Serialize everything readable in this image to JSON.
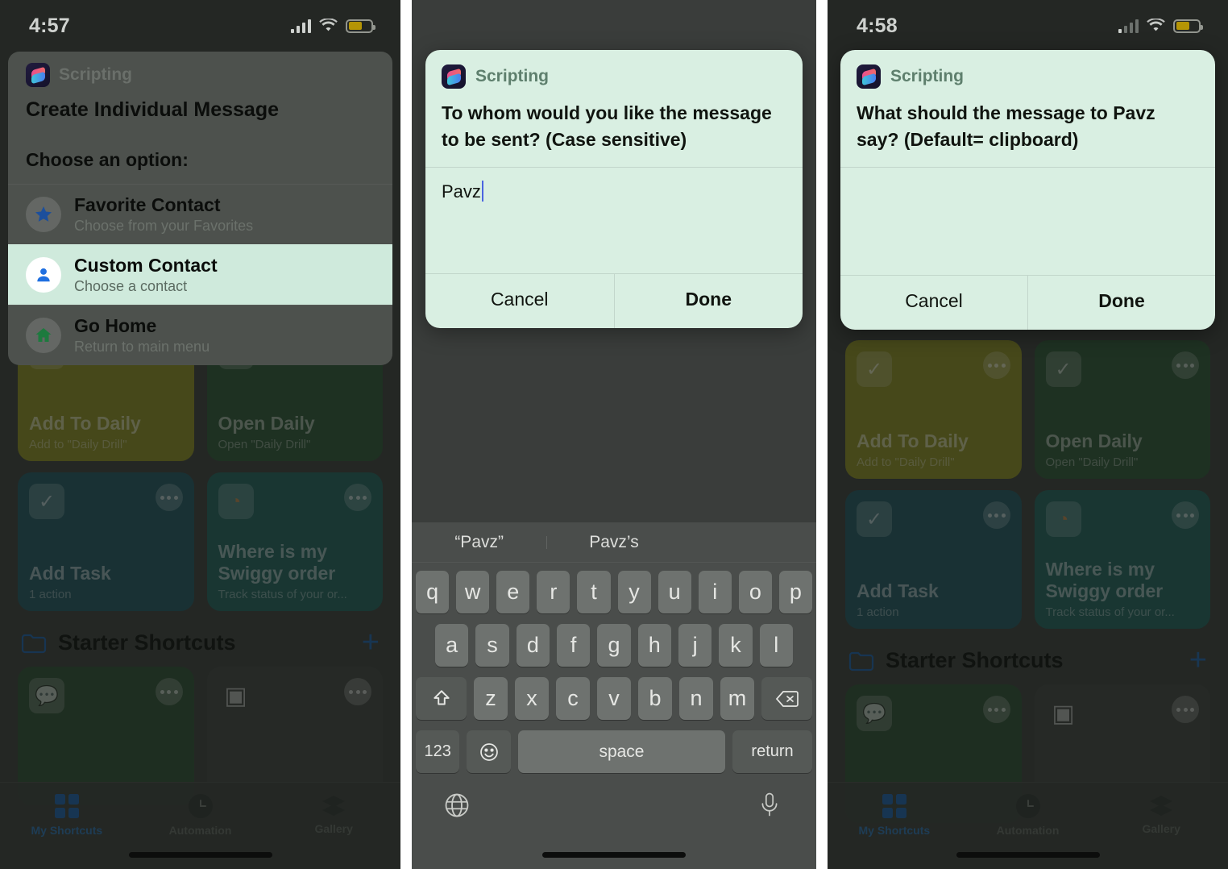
{
  "panels": [
    {
      "id": "panel-1",
      "status": {
        "time": "4:57",
        "battery_level": 62
      },
      "menu": {
        "app_name": "Scripting",
        "title": "Create Individual Message",
        "subtitle": "Choose an option:",
        "items": [
          {
            "title": "Favorite Contact",
            "subtitle": "Choose from your Favorites",
            "icon": "star-icon",
            "selected": false
          },
          {
            "title": "Custom Contact",
            "subtitle": "Choose a contact",
            "icon": "person-icon",
            "selected": true
          },
          {
            "title": "Go Home",
            "subtitle": "Return to main menu",
            "icon": "home-icon",
            "selected": false
          }
        ]
      }
    },
    {
      "id": "panel-2",
      "dialog": {
        "app_name": "Scripting",
        "prompt": "To whom would you like the message to be sent? (Case sensitive)",
        "input_value": "Pavz",
        "cancel_label": "Cancel",
        "done_label": "Done"
      },
      "keyboard": {
        "suggestions": [
          "“Pavz”",
          "Pavz’s",
          ""
        ],
        "row1": [
          "q",
          "w",
          "e",
          "r",
          "t",
          "y",
          "u",
          "i",
          "o",
          "p"
        ],
        "row2": [
          "a",
          "s",
          "d",
          "f",
          "g",
          "h",
          "j",
          "k",
          "l"
        ],
        "row3": [
          "z",
          "x",
          "c",
          "v",
          "b",
          "n",
          "m"
        ],
        "shift_label": "shift-icon",
        "backspace_label": "backspace-icon",
        "numbers_label": "123",
        "emoji_label": "emoji-icon",
        "space_label": "space",
        "return_label": "return",
        "globe_label": "globe-icon",
        "mic_label": "microphone-icon"
      }
    },
    {
      "id": "panel-3",
      "status": {
        "time": "4:58",
        "battery_level": 62
      },
      "dialog": {
        "app_name": "Scripting",
        "prompt": "What should the message to Pavz say? (Default= clipboard)",
        "input_value": "",
        "cancel_label": "Cancel",
        "done_label": "Done"
      }
    }
  ],
  "shortcuts_app": {
    "cards": [
      {
        "title": "Add To Daily",
        "subtitle": "Add to \"Daily Drill\"",
        "color": "#8a8a22",
        "icon": "checkmark-icon"
      },
      {
        "title": "Open Daily",
        "subtitle": "Open \"Daily Drill\"",
        "color": "#2c5335",
        "icon": "checkmark-icon"
      },
      {
        "title": "Add Task",
        "subtitle": "1 action",
        "color": "#1f5560",
        "icon": "checkmark-icon"
      },
      {
        "title": "Where is my Swiggy order",
        "subtitle": "Track status of your or...",
        "color": "#1f5f5c",
        "icon": "location-icon"
      }
    ],
    "section": {
      "title": "Starter Shortcuts",
      "add_label": "+",
      "folder_icon": "folder-icon"
    },
    "starter_cards": [
      {
        "title": "",
        "subtitle": "",
        "color": "#2d4c33",
        "icon": "message-add-icon"
      },
      {
        "title": "",
        "subtitle": "",
        "color": "#3f423f",
        "icon": "qr-code-icon"
      }
    ],
    "tabs": [
      {
        "label": "My Shortcuts",
        "icon": "grid-icon",
        "active": true
      },
      {
        "label": "Automation",
        "icon": "clock-icon",
        "active": false
      },
      {
        "label": "Gallery",
        "icon": "layers-icon",
        "active": false
      }
    ]
  },
  "colors": {
    "dialog_bg": "#d9efe2",
    "selected_row_bg": "#cfeadc",
    "accent_blue": "#1c5ea8",
    "caret": "#4b64e0",
    "battery": "#b59505"
  }
}
